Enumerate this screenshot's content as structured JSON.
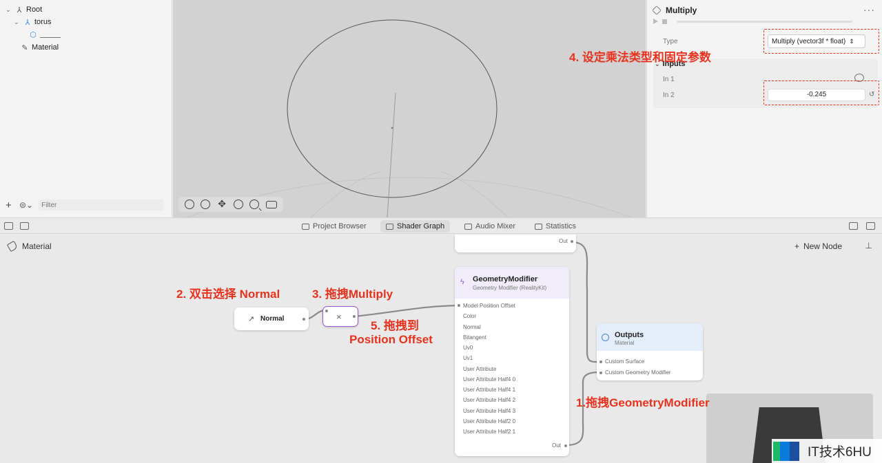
{
  "scene_tree": {
    "items": [
      {
        "label": "Root",
        "icon": "hierarchy-icon"
      },
      {
        "label": "torus",
        "icon": "model-entity-icon"
      },
      {
        "label": "",
        "icon": "mesh-icon"
      },
      {
        "label": "Material",
        "icon": "material-brush-icon"
      }
    ],
    "filter_placeholder": "Filter"
  },
  "inspector": {
    "title": "Multiply",
    "type_label": "Type",
    "type_value": "Multiply (vector3f * float)",
    "inputs_title": "Inputs",
    "in1_label": "In 1",
    "in2_label": "In 2",
    "in2_value": "-0.245"
  },
  "tabs": [
    {
      "label": "Project Browser",
      "icon": "folder-icon"
    },
    {
      "label": "Shader Graph",
      "icon": "shader-graph-icon",
      "active": true
    },
    {
      "label": "Audio Mixer",
      "icon": "audio-mixer-icon"
    },
    {
      "label": "Statistics",
      "icon": "statistics-icon"
    }
  ],
  "graph": {
    "breadcrumb": "Material",
    "new_node": "New Node",
    "top_node_out": "Out",
    "normal_node": {
      "title": "Normal"
    },
    "multiply_node": {
      "symbol": "×"
    },
    "geometry_modifier": {
      "title": "GeometryModifier",
      "subtitle": "Geometry Modifier (RealityKit)",
      "inputs": [
        "Model Position Offset",
        "Color",
        "Normal",
        "Bitangent",
        "Uv0",
        "Uv1",
        "User Attribute",
        "User Attribute Half4 0",
        "User Attribute Half4 1",
        "User Attribute Half4 2",
        "User Attribute Half4 3",
        "User Attribute Half2 0",
        "User Attribute Half2 1"
      ],
      "out": "Out"
    },
    "outputs_node": {
      "title": "Outputs",
      "subtitle": "Material",
      "inputs": [
        "Custom Surface",
        "Custom Geometry Modifier"
      ]
    }
  },
  "annotations": {
    "step1": "1.拖拽GeometryModifier",
    "step2": "2. 双击选择 Normal",
    "step3": "3. 拖拽Multiply",
    "step4": "4.  设定乘法类型和固定参数",
    "step5_line1": "5. 拖拽到",
    "step5_line2": "Position Offset"
  },
  "watermark": "IT技术6HU",
  "colors": {
    "annotation": "#e8321e",
    "multiply_selected": "#9a5ecf",
    "geometry_header": "#f1ecf9",
    "outputs_header": "#e4eefb"
  }
}
